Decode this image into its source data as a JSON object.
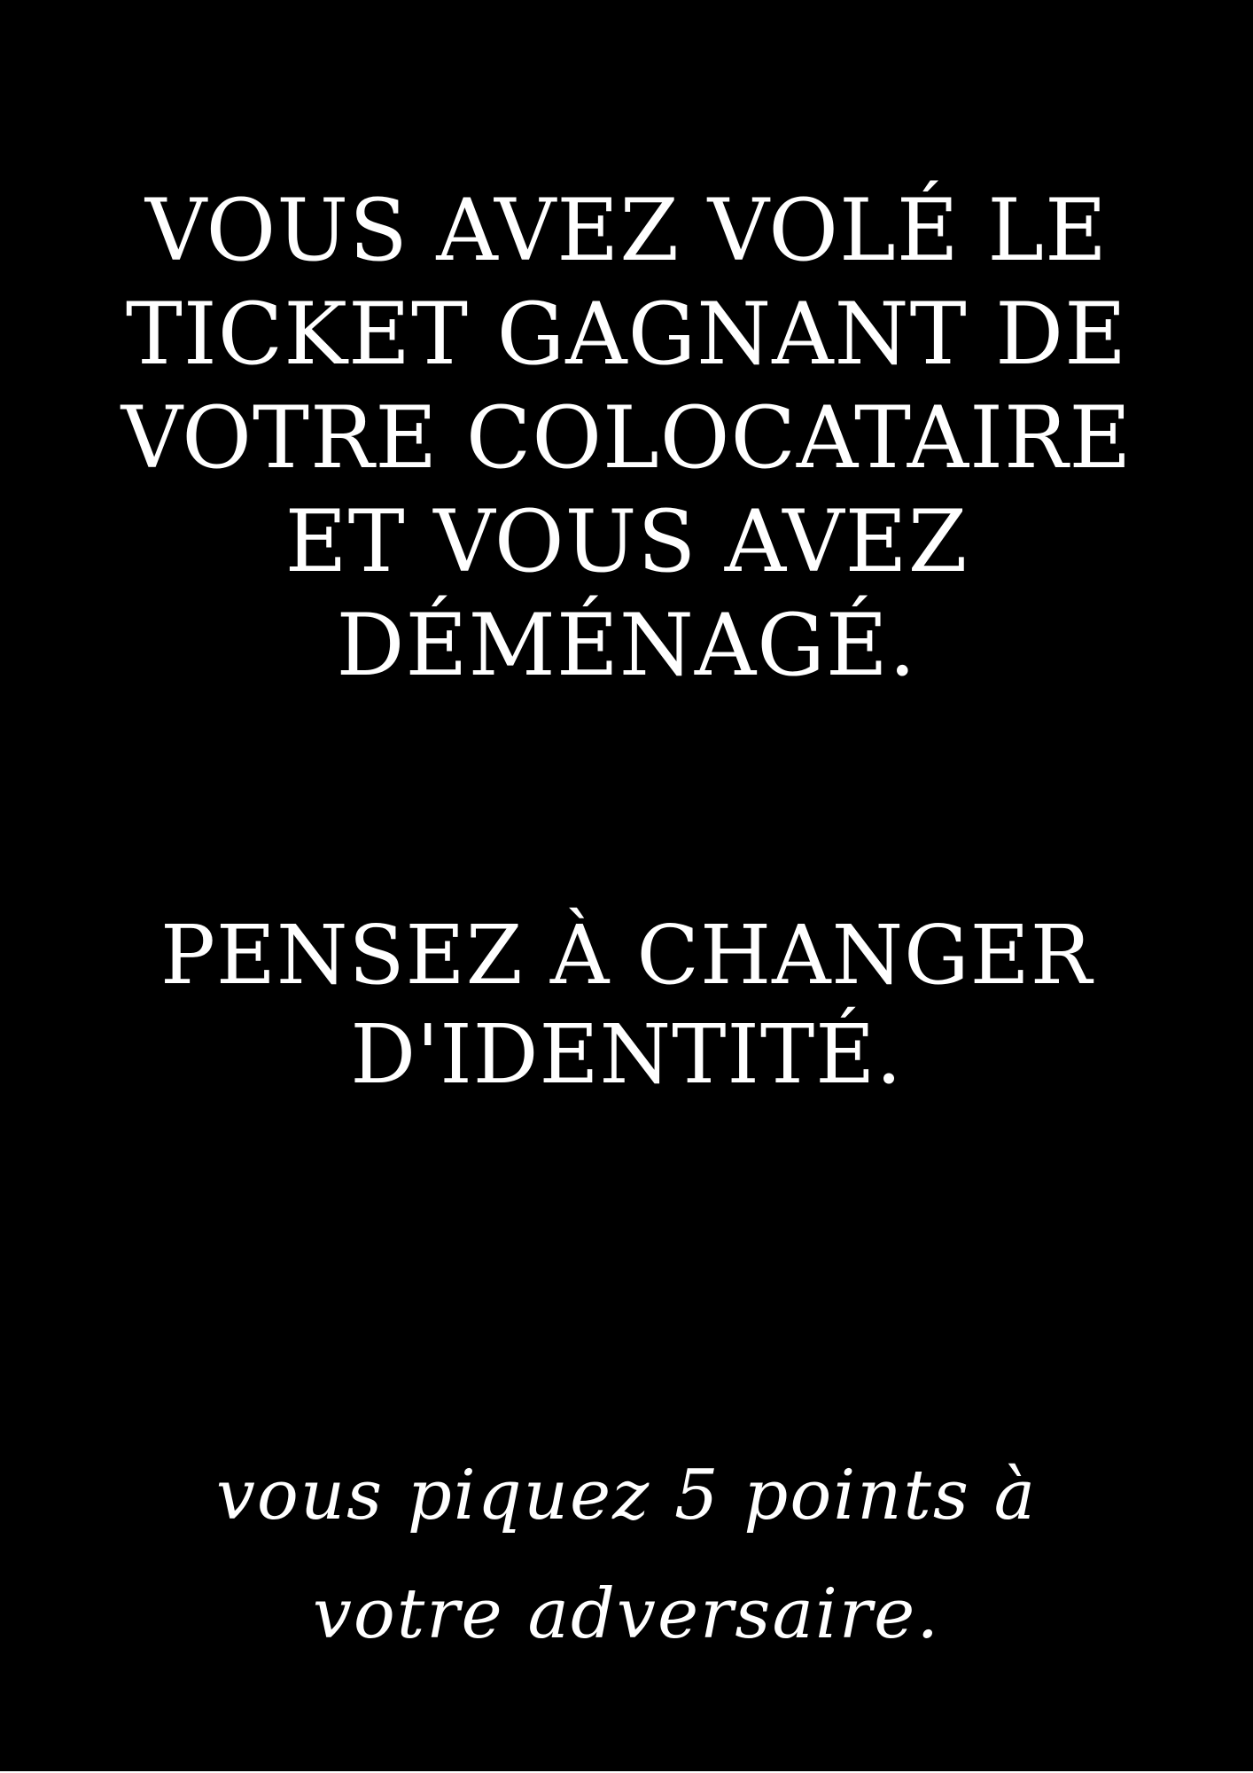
{
  "card": {
    "background_color": "#000000",
    "text_color": "#ffffff",
    "main_text_lines": [
      "VOUS AVEZ VOLÉ LE",
      "TICKET GAGNANT DE",
      "VOTRE COLOCATAIRE",
      "ET VOUS AVEZ",
      "DÉMÉNAGÉ."
    ],
    "hint_text_lines": [
      "PENSEZ À CHANGER",
      "D'IDENTITÉ."
    ],
    "effect_text_lines": [
      "vous piquez 5 points à",
      "votre adversaire."
    ]
  }
}
